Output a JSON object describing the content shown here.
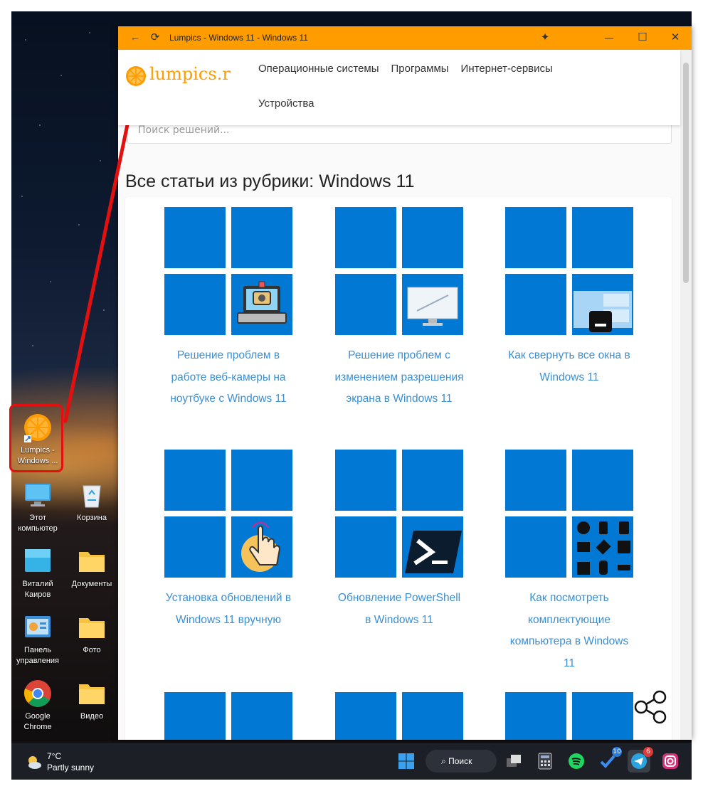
{
  "desktop": {
    "shortcut_highlighted": {
      "label": "Lumpics - Windows ..."
    },
    "icons": [
      {
        "label": "Этот компьютер"
      },
      {
        "label": "Корзина"
      },
      {
        "label": "Виталий Каиров"
      },
      {
        "label": "Документы"
      },
      {
        "label": "Панель управления"
      },
      {
        "label": "Фото"
      },
      {
        "label": "Google Chrome"
      },
      {
        "label": "Видео"
      }
    ]
  },
  "window": {
    "title": "Lumpics - Windows 11 - Windows 11",
    "controls": {
      "back": "←",
      "reload": "⟳",
      "extension": "✦",
      "minimize": "—",
      "maximize": "☐",
      "close": "✕"
    }
  },
  "site": {
    "logo_text": "lumpics.r",
    "nav": [
      "Операционные системы",
      "Программы",
      "Интернет-сервисы",
      "Устройства"
    ],
    "search_placeholder": "Поиск решений...",
    "heading": "Все статьи из рубрики: Windows 11",
    "articles": [
      {
        "title": "Решение проблем в работе веб-камеры на ноутбуке с Windows 11",
        "image": "laptop-camera-icon"
      },
      {
        "title": "Решение проблем с изменением разрешения экрана в Windows 11",
        "image": "monitor-resize-icon"
      },
      {
        "title": "Как свернуть все окна в Windows 11",
        "image": "minimize-windows-icon"
      },
      {
        "title": "Установка обновлений в Windows 11 вручную",
        "image": "hand-click-icon"
      },
      {
        "title": "Обновление PowerShell в Windows 11",
        "image": "powershell-icon"
      },
      {
        "title": "Как посмотреть комплектующие компьютера в Windows 11",
        "image": "hardware-components-icon"
      },
      {
        "title": "",
        "image": ""
      },
      {
        "title": "",
        "image": ""
      },
      {
        "title": "",
        "image": ""
      }
    ],
    "share_icon": "share-icon"
  },
  "taskbar": {
    "weather": {
      "temp": "7°C",
      "desc": "Partly sunny"
    },
    "search_label": "Поиск",
    "apps": [
      {
        "name": "start-button"
      },
      {
        "name": "task-view"
      },
      {
        "name": "calculator"
      },
      {
        "name": "spotify"
      },
      {
        "name": "todo",
        "badge": "10"
      },
      {
        "name": "telegram",
        "badge": "6"
      },
      {
        "name": "instagram"
      }
    ]
  },
  "colors": {
    "accent": "#ff9c00",
    "tile": "#0078d4",
    "link": "#3b8fd3",
    "highlight": "#e3100f"
  }
}
